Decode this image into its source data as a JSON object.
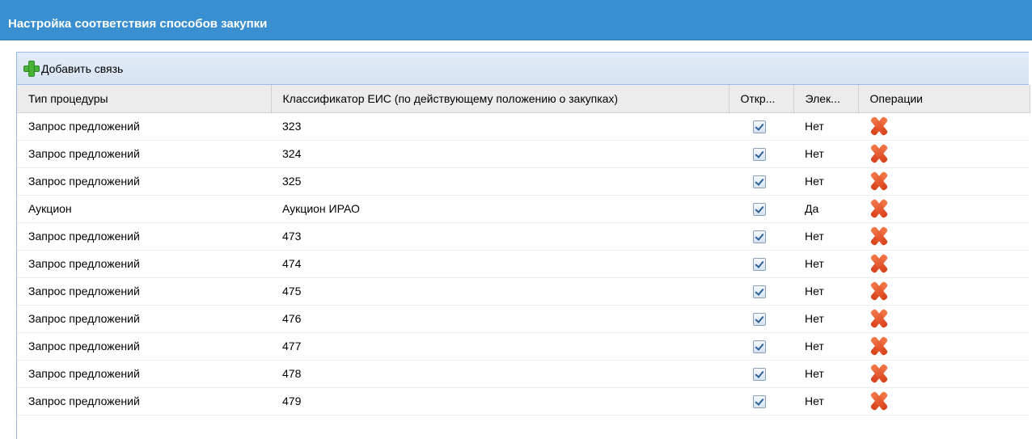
{
  "window": {
    "title": "Настройка соответствия способов закупки"
  },
  "toolbar": {
    "add_label": "Добавить связь",
    "add_icon": "plus-icon"
  },
  "table": {
    "headers": [
      "Тип процедуры",
      "Классификатор ЕИС (по действующему положению о закупках)",
      "Откр...",
      "Элек...",
      "Операции"
    ],
    "rows": [
      {
        "type": "Запрос предложений",
        "code": "323",
        "open": true,
        "elec": "Нет"
      },
      {
        "type": "Запрос предложений",
        "code": "324",
        "open": true,
        "elec": "Нет"
      },
      {
        "type": "Запрос предложений",
        "code": "325",
        "open": true,
        "elec": "Нет"
      },
      {
        "type": "Аукцион",
        "code": "Аукцион ИРАО",
        "open": true,
        "elec": "Да"
      },
      {
        "type": "Запрос предложений",
        "code": "473",
        "open": true,
        "elec": "Нет"
      },
      {
        "type": "Запрос предложений",
        "code": "474",
        "open": true,
        "elec": "Нет"
      },
      {
        "type": "Запрос предложений",
        "code": "475",
        "open": true,
        "elec": "Нет"
      },
      {
        "type": "Запрос предложений",
        "code": "476",
        "open": true,
        "elec": "Нет"
      },
      {
        "type": "Запрос предложений",
        "code": "477",
        "open": true,
        "elec": "Нет"
      },
      {
        "type": "Запрос предложений",
        "code": "478",
        "open": true,
        "elec": "Нет"
      },
      {
        "type": "Запрос предложений",
        "code": "479",
        "open": true,
        "elec": "Нет"
      }
    ]
  },
  "colors": {
    "title_bar": "#3a8fd0",
    "delete_icon": "#e0502a",
    "add_icon": "#49b337"
  }
}
